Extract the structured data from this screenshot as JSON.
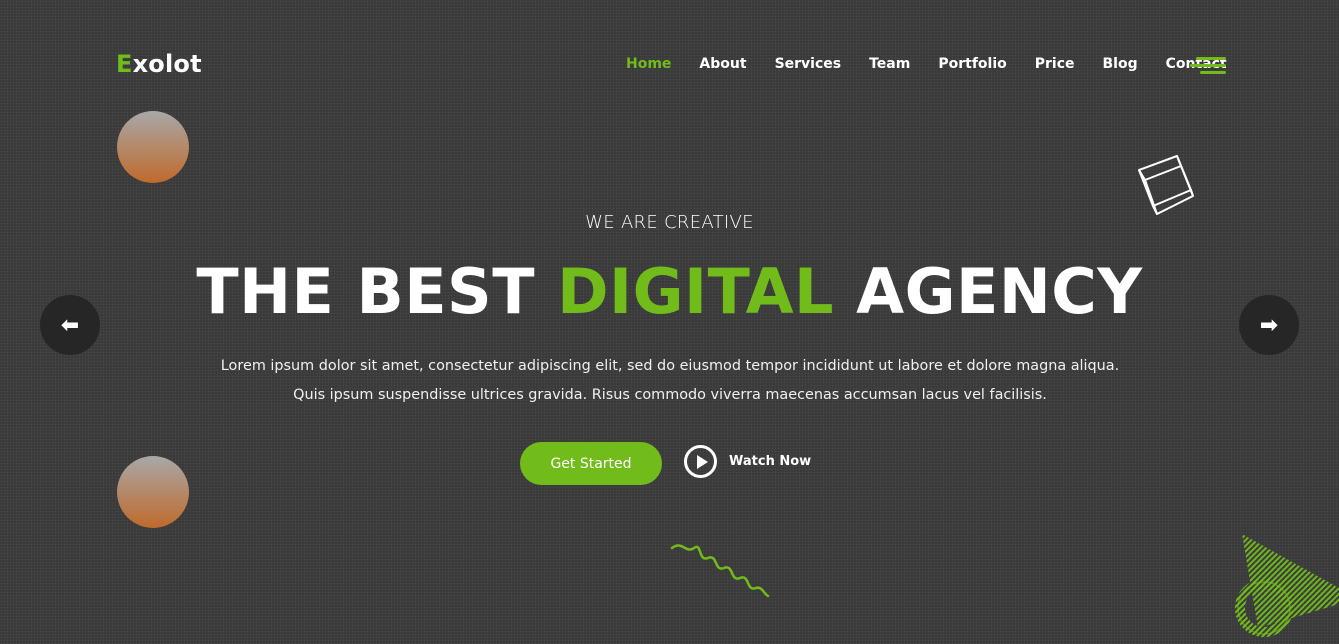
{
  "brand": {
    "first_letter": "E",
    "rest": "xolot",
    "accent_color": "#71bc1b"
  },
  "nav": {
    "items": [
      {
        "label": "Home",
        "active": true
      },
      {
        "label": "About"
      },
      {
        "label": "Services"
      },
      {
        "label": "Team"
      },
      {
        "label": "Portfolio"
      },
      {
        "label": "Price"
      },
      {
        "label": "Blog"
      },
      {
        "label": "Contact"
      }
    ],
    "menu_icon": "hamburger-icon"
  },
  "hero": {
    "eyebrow": "WE ARE CREATIVE",
    "headline_part1": "THE BEST ",
    "headline_highlight": "DIGITAL",
    "headline_part2": " AGENCY",
    "description": "Lorem ipsum dolor sit amet, consectetur adipiscing elit, sed do eiusmod tempor incididunt ut labore et dolore magna aliqua. Quis ipsum suspendisse ultrices gravida. Risus commodo viverra maecenas accumsan lacus vel facilisis.",
    "primary_button": "Get Started",
    "secondary_button": "Watch Now"
  },
  "slider": {
    "prev_icon": "arrow-left-icon",
    "next_icon": "arrow-right-icon",
    "prev_glyph": "⬅",
    "next_glyph": "➡"
  },
  "colors": {
    "background": "#3d3d3d",
    "accent": "#71bc1b",
    "ball_top": "#a8a8a8",
    "ball_bottom": "#c06a2b"
  }
}
